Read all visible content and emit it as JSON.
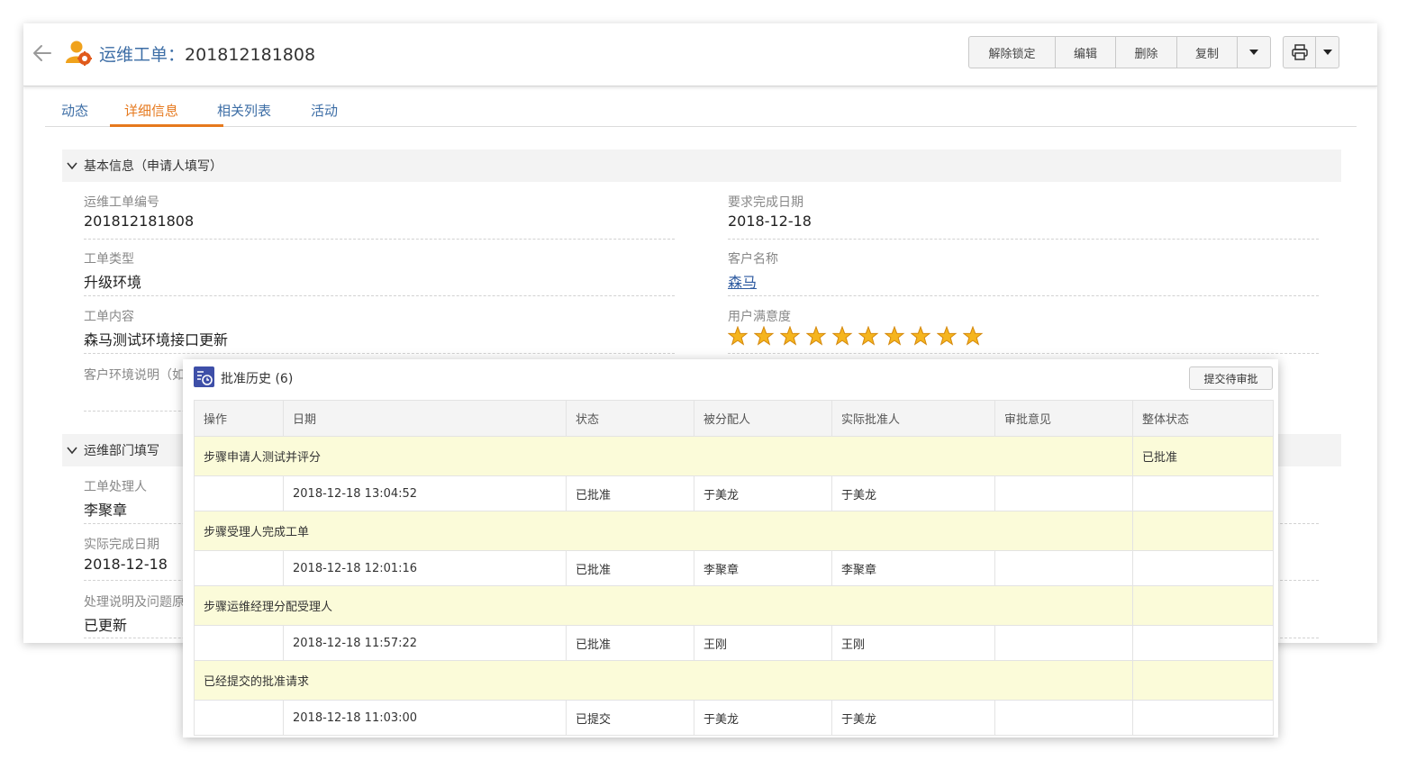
{
  "header": {
    "title_prefix": "运维工单：",
    "record_number": "201812181808",
    "buttons": {
      "unlock": "解除锁定",
      "edit": "编辑",
      "delete": "删除",
      "copy": "复制"
    }
  },
  "tabs": [
    {
      "label": "动态"
    },
    {
      "label": "详细信息"
    },
    {
      "label": "相关列表"
    },
    {
      "label": "活动"
    }
  ],
  "section_basic": {
    "title": "基本信息（申请人填写）",
    "fields": {
      "ticket_no": {
        "label": "运维工单编号",
        "value": "201812181808"
      },
      "due_date": {
        "label": "要求完成日期",
        "value": "2018-12-18"
      },
      "ticket_type": {
        "label": "工单类型",
        "value": "升级环境"
      },
      "customer": {
        "label": "客户名称",
        "value": "森马"
      },
      "content": {
        "label": "工单内容",
        "value": "森马测试环境接口更新"
      },
      "satisfaction": {
        "label": "用户满意度",
        "stars": 10
      },
      "env_note": {
        "label": "客户环境说明（如"
      }
    }
  },
  "section_ops": {
    "title": "运维部门填写",
    "fields": {
      "handler": {
        "label": "工单处理人",
        "value": "李聚章"
      },
      "actual_date": {
        "label": "实际完成日期",
        "value": "2018-12-18"
      },
      "resolution": {
        "label": "处理说明及问题原",
        "value": "已更新"
      }
    }
  },
  "approval": {
    "title": "批准历史 (6)",
    "submit_button": "提交待审批",
    "columns": [
      "操作",
      "日期",
      "状态",
      "被分配人",
      "实际批准人",
      "审批意见",
      "整体状态"
    ],
    "rows": [
      {
        "type": "step",
        "label": "步骤申请人测试并评分",
        "overall": "已批准"
      },
      {
        "type": "rec",
        "date": "2018-12-18 13:04:52",
        "status": "已批准",
        "assignee": "于美龙",
        "approver": "于美龙"
      },
      {
        "type": "step",
        "label": "步骤受理人完成工单",
        "overall": ""
      },
      {
        "type": "rec",
        "date": "2018-12-18 12:01:16",
        "status": "已批准",
        "assignee": "李聚章",
        "approver": "李聚章"
      },
      {
        "type": "step",
        "label": "步骤运维经理分配受理人",
        "overall": ""
      },
      {
        "type": "rec",
        "date": "2018-12-18 11:57:22",
        "status": "已批准",
        "assignee": "王刚",
        "approver": "王刚"
      },
      {
        "type": "step",
        "label": "已经提交的批准请求",
        "overall": ""
      },
      {
        "type": "rec",
        "date": "2018-12-18 11:03:00",
        "status": "已提交",
        "assignee": "于美龙",
        "approver": "于美龙"
      }
    ]
  }
}
